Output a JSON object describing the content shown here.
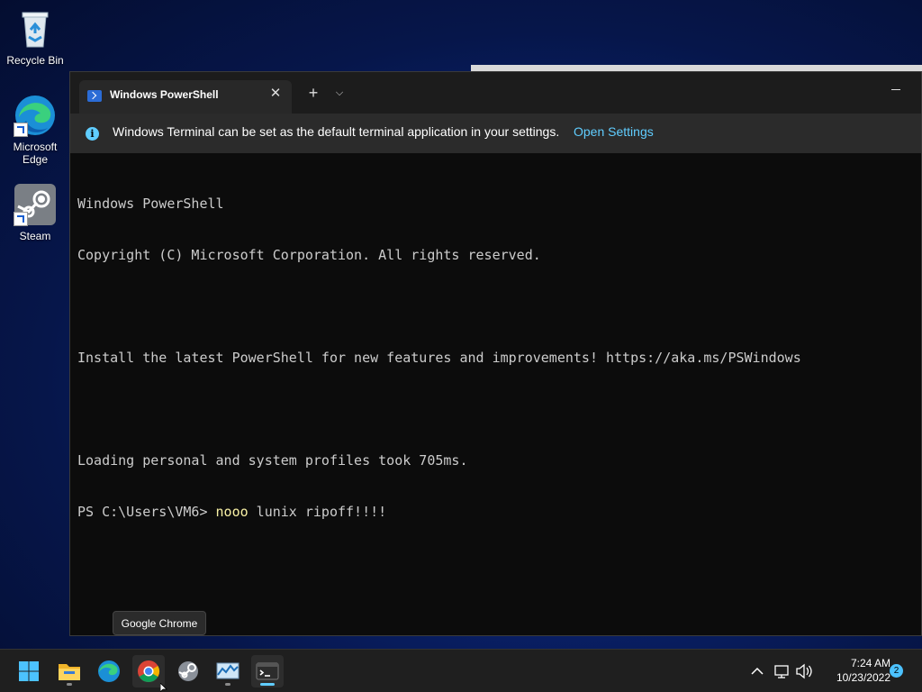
{
  "desktop": {
    "icons": [
      {
        "label": "Recycle Bin"
      },
      {
        "label": "Microsoft Edge"
      },
      {
        "label": "Steam"
      }
    ]
  },
  "terminal": {
    "tab_title": "Windows PowerShell",
    "infobar": {
      "message": "Windows Terminal can be set as the default terminal application in your settings.",
      "link": "Open Settings"
    },
    "lines": [
      "Windows PowerShell",
      "Copyright (C) Microsoft Corporation. All rights reserved.",
      "",
      "Install the latest PowerShell for new features and improvements! https://aka.ms/PSWindows",
      "",
      "Loading personal and system profiles took 705ms."
    ],
    "prompt": "PS C:\\Users\\VM6> ",
    "command_keyword": "nooo",
    "command_rest": " lunix ripoff!!!!"
  },
  "tooltip": "Google Chrome",
  "taskbar": {
    "apps": [
      "start",
      "file-explorer",
      "edge",
      "chrome",
      "steam",
      "task-manager",
      "terminal"
    ],
    "time": "7:24 AM",
    "date": "10/23/2022",
    "notifications": "2"
  },
  "colors": {
    "accent": "#60cdff",
    "console_text": "#cccccc",
    "command_highlight": "#f9f1a5"
  }
}
